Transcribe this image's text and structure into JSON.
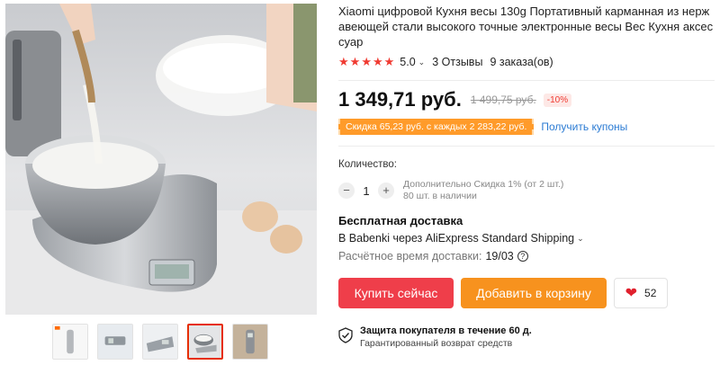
{
  "product": {
    "title": "Xiaomi цифровой Кухня весы 130g Портативный карманная из нержавеющей стали высокого точные электронные весы Вес Кухня аксессуар",
    "stars": [
      "★",
      "★",
      "★",
      "★",
      "★"
    ],
    "rating": "5.0",
    "reviews": "3 Отзывы",
    "orders": "9 заказа(ов)"
  },
  "price": {
    "current": "1 349,71 руб.",
    "old": "1 499,75 руб.",
    "discount": "-10%"
  },
  "coupon": {
    "badge": "Скидка 65,23 руб. с каждых 2 283,22 руб.",
    "link": "Получить купоны"
  },
  "quantity": {
    "label": "Количество:",
    "minus": "−",
    "value": "1",
    "plus": "+",
    "note_line1": "Дополнительно Скидка 1% (от 2 шт.)",
    "note_line2": "80 шт. в наличии"
  },
  "shipping": {
    "title": "Бесплатная доставка",
    "via": "В Babenki через AliExpress Standard Shipping",
    "time_label": "Расчётное время доставки:",
    "time_value": "19/03",
    "help": "?"
  },
  "actions": {
    "buy": "Купить сейчас",
    "cart": "Добавить в корзину",
    "wishlist_count": "52"
  },
  "protection": {
    "title": "Защита покупателя в течение 60 д.",
    "subtitle": "Гарантированный возврат средств"
  },
  "colors": {
    "accent_red": "#ef3e4a",
    "accent_orange": "#f7921e",
    "star_red": "#f03b32",
    "link_blue": "#2b7bd3"
  }
}
